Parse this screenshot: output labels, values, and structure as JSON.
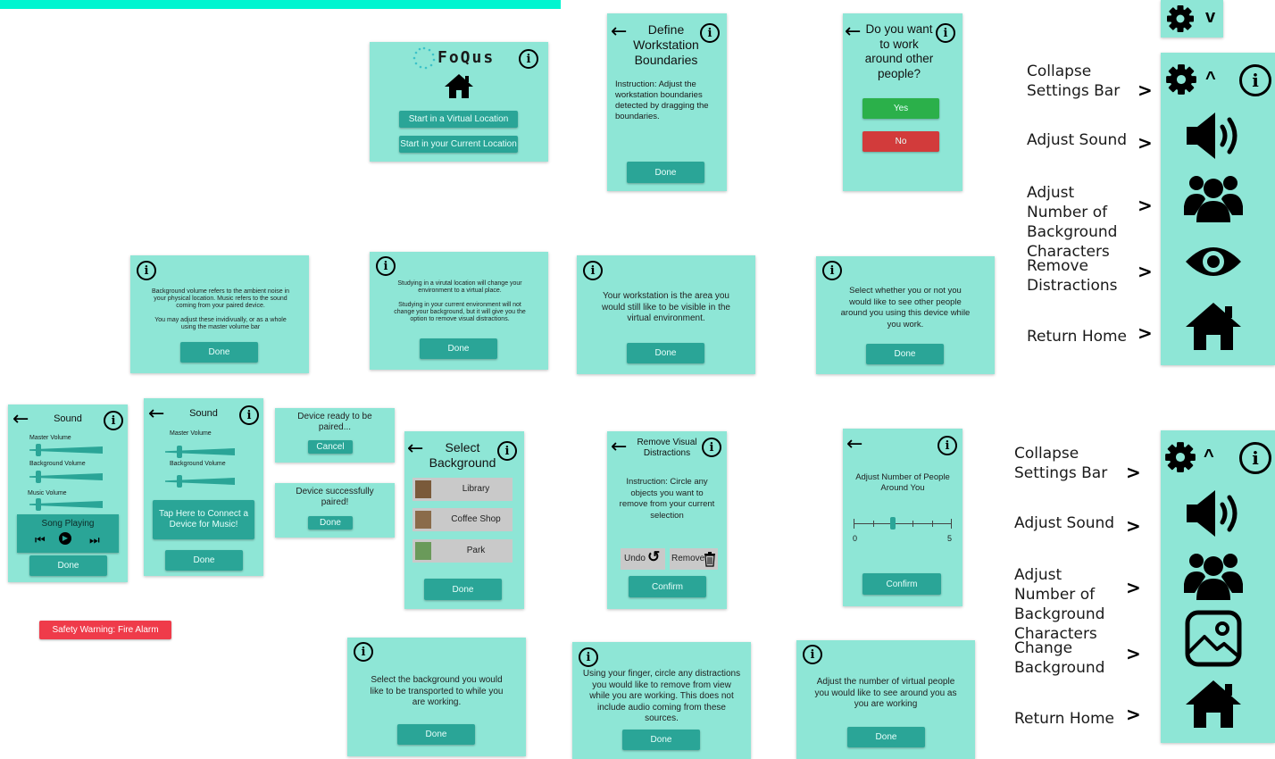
{
  "main": {
    "app_name": "FoQus",
    "start_virtual": "Start in a Virtual Location",
    "start_current": "Start in your Current Location"
  },
  "workstation": {
    "title": "Define Workstation Boundaries",
    "instruction": "Instruction: Adjust the workstation boundaries detected by dragging the boundaries.",
    "done": "Done"
  },
  "others_prompt": {
    "title": "Do you want to work around other people?",
    "yes": "Yes",
    "no": "No"
  },
  "settings_top": {
    "collapsed_chevron": "v",
    "expanded_chevron": "^",
    "collapse": "Collapse Settings Bar",
    "sound": "Adjust Sound",
    "characters": "Adjust Number of Background Characters",
    "distractions": "Remove Distractions",
    "home": "Return Home",
    "arrow": ">"
  },
  "settings_bottom": {
    "expanded_chevron": "^",
    "collapse": "Collapse Settings Bar",
    "sound": "Adjust Sound",
    "characters": "Adjust Number of Background Characters",
    "background": "Change Background",
    "home": "Return Home",
    "arrow": ">"
  },
  "info_volume": {
    "text1": "Background volume refers to the ambient noise in your physical location. Music refers to the sound coming from your paired device.",
    "text2": "You may adjust these invidivually, or as a whole using the master volume bar",
    "done": "Done"
  },
  "info_location": {
    "text1": "Studying in a virutal location will change your environment to a virtual place.",
    "text2": "Studying in your current environment will not change your background, but it will give you the option to remove visual distractions.",
    "done": "Done"
  },
  "info_workstation": {
    "text": "Your workstation is the area you would still like to be visible in the virtual environment.",
    "done": "Done"
  },
  "info_people": {
    "text": "Select whether you or not you would like to see other people around you using this device while you work.",
    "done": "Done"
  },
  "sound1": {
    "title": "Sound",
    "master": "Master Volume",
    "background": "Background Volume",
    "music": "Music Volume",
    "song": "Song Playing",
    "done": "Done"
  },
  "sound2": {
    "title": "Sound",
    "master": "Master Volume",
    "background": "Background Volume",
    "connect": "Tap Here to Connect a Device for Music!",
    "done": "Done"
  },
  "pairing": {
    "ready": "Device ready to be paired...",
    "cancel": "Cancel",
    "success": "Device successfully paired!",
    "done": "Done"
  },
  "select_bg": {
    "title": "Select Background",
    "items": [
      "Library",
      "Coffee Shop",
      "Park"
    ],
    "done": "Done"
  },
  "remove_visual": {
    "title": "Remove Visual Distractions",
    "instruction": "Instruction: Circle any objects you want to remove from your current selection",
    "undo": "Undo",
    "remove": "Remove",
    "confirm": "Confirm"
  },
  "people_count": {
    "title": "Adjust Number of People Around You",
    "min": "0",
    "max": "5",
    "confirm": "Confirm"
  },
  "warning": "Safety Warning: Fire Alarm",
  "info_bg": {
    "text": "Select the background you would like to be transported to while you are working.",
    "done": "Done"
  },
  "info_distractions": {
    "text": "Using your finger, circle any distractions you would like to remove from view while you are working. This does not include audio coming from these sources.",
    "done": "Done"
  },
  "info_virtual_people": {
    "text": "Adjust the number of virtual people you would like to see around you as you are working",
    "done": "Done"
  },
  "icons": {
    "info": "info-icon",
    "back": "back-arrow-icon",
    "gear": "gear-icon",
    "speaker": "speaker-icon",
    "people": "people-icon",
    "eye": "eye-icon",
    "home": "home-icon",
    "image": "image-icon"
  },
  "colors": {
    "panel": "#8ee6d6",
    "button": "#2aa597",
    "accent_bar": "#00f5d0",
    "yes": "#2bb04a",
    "no": "#d23b3b",
    "warning": "#ef3b4a"
  }
}
